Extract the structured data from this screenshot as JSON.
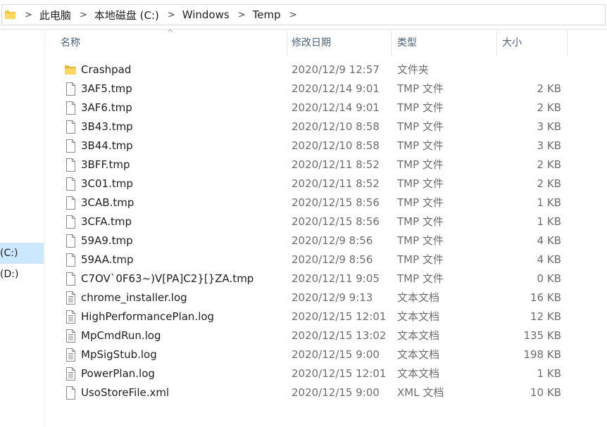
{
  "breadcrumb": [
    "此电脑",
    "本地磁盘 (C:)",
    "Windows",
    "Temp"
  ],
  "nav": {
    "items": [
      {
        "label": "(C:)",
        "selected": true
      },
      {
        "label": "(D:)",
        "selected": false
      }
    ]
  },
  "columns": {
    "name": "名称",
    "date": "修改日期",
    "type": "类型",
    "size": "大小"
  },
  "sort_indicator": "^",
  "files": [
    {
      "icon": "folder-icon",
      "name": "Crashpad",
      "date": "2020/12/9 12:57",
      "type": "文件夹",
      "size": ""
    },
    {
      "icon": "file-icon",
      "name": "3AF5.tmp",
      "date": "2020/12/14 9:01",
      "type": "TMP 文件",
      "size": "2 KB"
    },
    {
      "icon": "file-icon",
      "name": "3AF6.tmp",
      "date": "2020/12/14 9:01",
      "type": "TMP 文件",
      "size": "2 KB"
    },
    {
      "icon": "file-icon",
      "name": "3B43.tmp",
      "date": "2020/12/10 8:58",
      "type": "TMP 文件",
      "size": "3 KB"
    },
    {
      "icon": "file-icon",
      "name": "3B44.tmp",
      "date": "2020/12/10 8:58",
      "type": "TMP 文件",
      "size": "3 KB"
    },
    {
      "icon": "file-icon",
      "name": "3BFF.tmp",
      "date": "2020/12/11 8:52",
      "type": "TMP 文件",
      "size": "2 KB"
    },
    {
      "icon": "file-icon",
      "name": "3C01.tmp",
      "date": "2020/12/11 8:52",
      "type": "TMP 文件",
      "size": "2 KB"
    },
    {
      "icon": "file-icon",
      "name": "3CAB.tmp",
      "date": "2020/12/15 8:56",
      "type": "TMP 文件",
      "size": "1 KB"
    },
    {
      "icon": "file-icon",
      "name": "3CFA.tmp",
      "date": "2020/12/15 8:56",
      "type": "TMP 文件",
      "size": "1 KB"
    },
    {
      "icon": "file-icon",
      "name": "59A9.tmp",
      "date": "2020/12/9 8:56",
      "type": "TMP 文件",
      "size": "4 KB"
    },
    {
      "icon": "file-icon",
      "name": "59AA.tmp",
      "date": "2020/12/9 8:56",
      "type": "TMP 文件",
      "size": "4 KB"
    },
    {
      "icon": "file-icon",
      "name": "C7OV`0F63~)V[PA]C2}[}ZA.tmp",
      "date": "2020/12/11 9:05",
      "type": "TMP 文件",
      "size": "0 KB"
    },
    {
      "icon": "text-file-icon",
      "name": "chrome_installer.log",
      "date": "2020/12/9 9:13",
      "type": "文本文档",
      "size": "16 KB"
    },
    {
      "icon": "text-file-icon",
      "name": "HighPerformancePlan.log",
      "date": "2020/12/15 12:01",
      "type": "文本文档",
      "size": "12 KB"
    },
    {
      "icon": "text-file-icon",
      "name": "MpCmdRun.log",
      "date": "2020/12/15 13:02",
      "type": "文本文档",
      "size": "135 KB"
    },
    {
      "icon": "text-file-icon",
      "name": "MpSigStub.log",
      "date": "2020/12/15 9:00",
      "type": "文本文档",
      "size": "198 KB"
    },
    {
      "icon": "text-file-icon",
      "name": "PowerPlan.log",
      "date": "2020/12/15 12:01",
      "type": "文本文档",
      "size": "1 KB"
    },
    {
      "icon": "file-icon",
      "name": "UsoStoreFile.xml",
      "date": "2020/12/15 9:00",
      "type": "XML 文档",
      "size": "10 KB"
    }
  ]
}
